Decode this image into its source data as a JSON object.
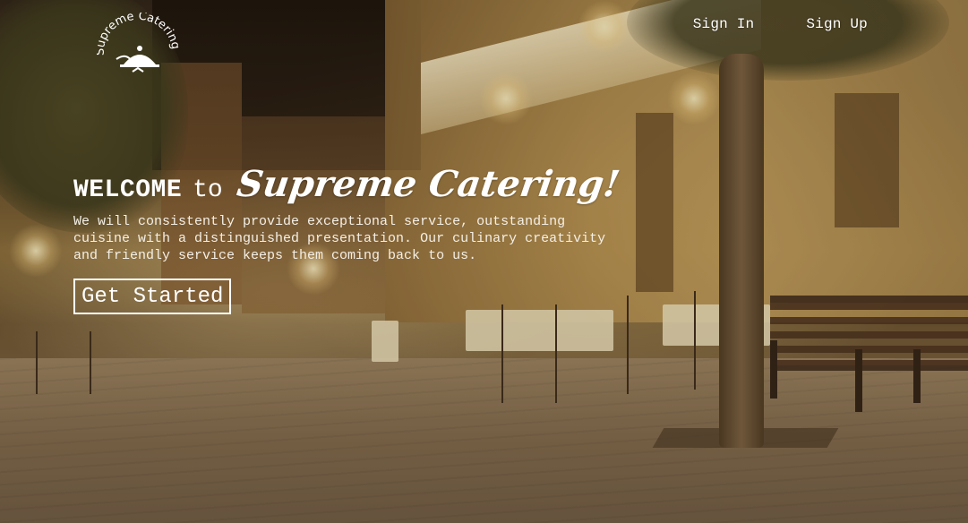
{
  "brand": {
    "logo_text": "Supreme Catering"
  },
  "nav": {
    "sign_in": "Sign In",
    "sign_up": "Sign Up"
  },
  "hero": {
    "welcome": "WELCOME",
    "to": "to",
    "brand_name": "Supreme Catering!",
    "tagline": "We will consistently provide exceptional service, outstanding cuisine with a distinguished presentation. Our culinary creativity and friendly service keeps them coming back to us.",
    "cta_label": "Get Started"
  },
  "colors": {
    "text": "#ffffff",
    "overlay": "#3c280f"
  },
  "icons": {
    "logo": "catering-cloche-icon"
  }
}
